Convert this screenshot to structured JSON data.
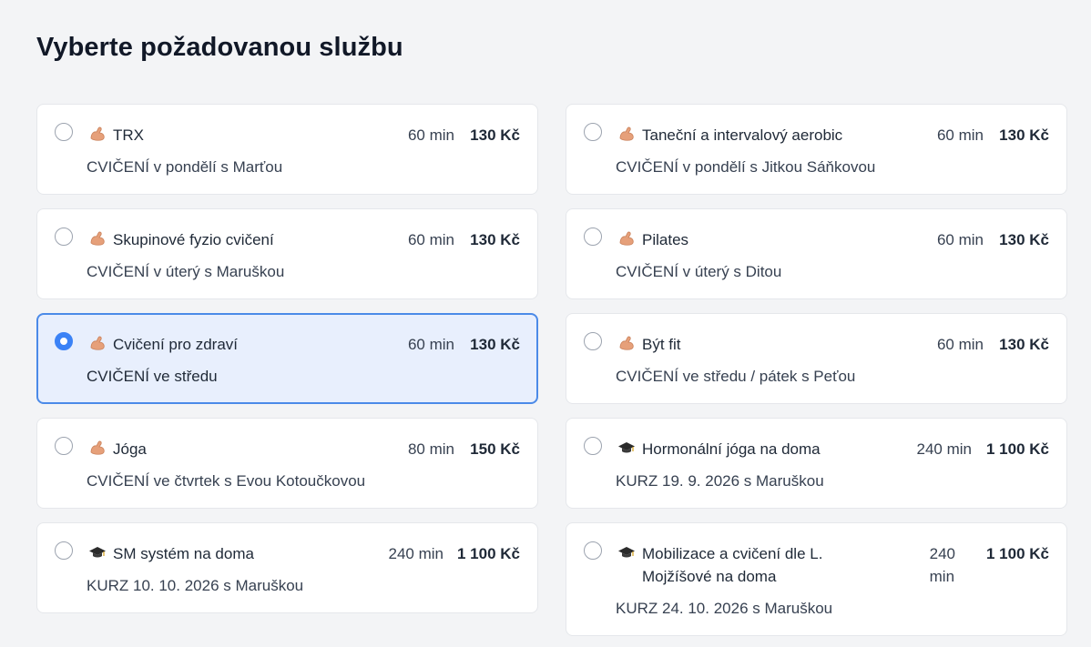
{
  "page": {
    "title": "Vyberte požadovanou službu"
  },
  "services": [
    {
      "name": "TRX",
      "icon": "flexed-biceps-icon",
      "duration": "60 min",
      "price": "130 Kč",
      "description": "CVIČENÍ v pondělí s Marťou",
      "selected": false
    },
    {
      "name": "Taneční a intervalový aerobic",
      "icon": "flexed-biceps-icon",
      "duration": "60 min",
      "price": "130 Kč",
      "description": "CVIČENÍ v pondělí s Jitkou Sáňkovou",
      "selected": false
    },
    {
      "name": "Skupinové fyzio cvičení",
      "icon": "flexed-biceps-icon",
      "duration": "60 min",
      "price": "130 Kč",
      "description": "CVIČENÍ v úterý s Maruškou",
      "selected": false
    },
    {
      "name": "Pilates",
      "icon": "flexed-biceps-icon",
      "duration": "60 min",
      "price": "130 Kč",
      "description": "CVIČENÍ v úterý s Ditou",
      "selected": false
    },
    {
      "name": "Cvičení pro zdraví",
      "icon": "flexed-biceps-icon",
      "duration": "60 min",
      "price": "130 Kč",
      "description": "CVIČENÍ ve středu",
      "selected": true
    },
    {
      "name": "Být fit",
      "icon": "flexed-biceps-icon",
      "duration": "60 min",
      "price": "130 Kč",
      "description": "CVIČENÍ ve středu / pátek s Peťou",
      "selected": false
    },
    {
      "name": "Jóga",
      "icon": "flexed-biceps-icon",
      "duration": "80 min",
      "price": "150 Kč",
      "description": "CVIČENÍ ve čtvrtek s Evou Kotoučkovou",
      "selected": false
    },
    {
      "name": "Hormonální jóga na doma",
      "icon": "graduation-cap-icon",
      "duration": "240 min",
      "price": "1 100 Kč",
      "description": "KURZ 19. 9. 2026 s Maruškou",
      "selected": false
    },
    {
      "name": "SM systém na doma",
      "icon": "graduation-cap-icon",
      "duration": "240 min",
      "price": "1 100 Kč",
      "description": "KURZ 10. 10. 2026 s Maruškou",
      "selected": false
    },
    {
      "name_line1": "Mobilizace a cvičení dle L.",
      "name_line2": "Mojžíšové na doma",
      "icon": "graduation-cap-icon",
      "duration_line1": "240",
      "duration_line2": "min",
      "price": "1 100 Kč",
      "description": "KURZ 24. 10. 2026 s Maruškou",
      "selected": false
    }
  ],
  "colors": {
    "background": "#f3f4f6",
    "card": "#ffffff",
    "selected_card": "#e8effd",
    "selected_border": "#4b8ae8",
    "radio_selected": "#3b82f6"
  }
}
